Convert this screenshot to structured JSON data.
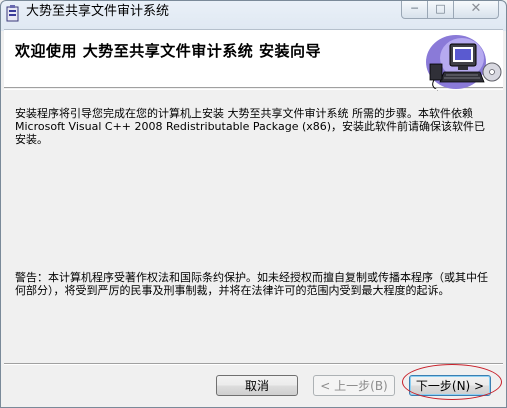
{
  "window": {
    "title": "大势至共享文件审计系统",
    "controls": {
      "minimize": "─",
      "maximize": "□",
      "close": "✕"
    }
  },
  "banner": {
    "title": "欢迎使用 大势至共享文件审计系统 安装向导",
    "art_icon": "computer-setup-icon"
  },
  "body": {
    "intro": "安装程序将引导您完成在您的计算机上安装 大势至共享文件审计系统 所需的步骤。本软件依赖Microsoft Visual C++ 2008 Redistributable Package (x86)，安装此软件前请确保该软件已安装。",
    "warning": "警告：本计算机程序受著作权法和国际条约保护。如未经授权而擅自复制或传播本程序（或其中任何部分），将受到严厉的民事及刑事制裁，并将在法律许可的范围内受到最大程度的起诉。"
  },
  "buttons": {
    "cancel": "取消",
    "back": "< 上一步(B)",
    "next": "下一步(N) >"
  },
  "colors": {
    "annotation": "#c8202a",
    "accent_border": "#3c7fb1"
  }
}
